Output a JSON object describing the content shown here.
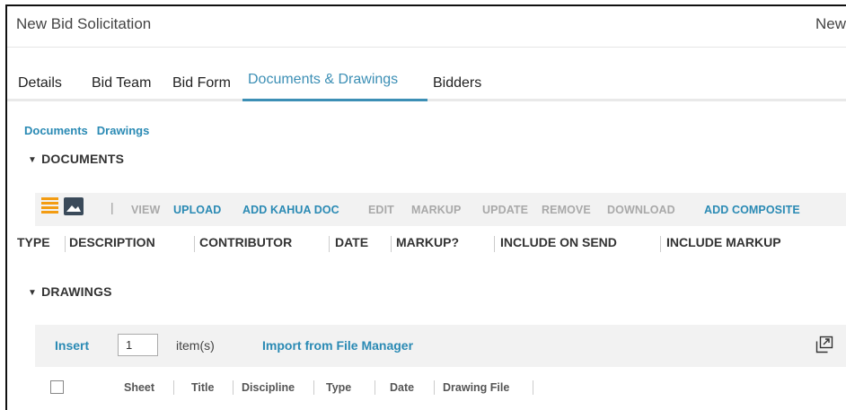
{
  "header": {
    "title": "New Bid Solicitation",
    "title_right": "New"
  },
  "tabs": [
    {
      "label": "Details"
    },
    {
      "label": "Bid Team"
    },
    {
      "label": "Bid Form"
    },
    {
      "label": "Documents & Drawings",
      "active": true
    },
    {
      "label": "Bidders"
    }
  ],
  "sublinks": [
    {
      "label": "Documents"
    },
    {
      "label": "Drawings"
    }
  ],
  "documents": {
    "heading": "DOCUMENTS",
    "toolbar": {
      "separator": "|",
      "buttons": [
        {
          "label": "VIEW",
          "enabled": false
        },
        {
          "label": "UPLOAD",
          "enabled": true
        },
        {
          "label": "ADD KAHUA DOC",
          "enabled": true
        },
        {
          "label": "EDIT",
          "enabled": false
        },
        {
          "label": "MARKUP",
          "enabled": false
        },
        {
          "label": "UPDATE",
          "enabled": false
        },
        {
          "label": "REMOVE",
          "enabled": false
        },
        {
          "label": "DOWNLOAD",
          "enabled": false
        },
        {
          "label": "ADD COMPOSITE",
          "enabled": true
        }
      ]
    },
    "columns": [
      "TYPE",
      "DESCRIPTION",
      "CONTRIBUTOR",
      "DATE",
      "MARKUP?",
      "INCLUDE ON SEND",
      "INCLUDE MARKUP"
    ]
  },
  "drawings": {
    "heading": "DRAWINGS",
    "toolbar": {
      "insert_label": "Insert",
      "count_value": "1",
      "items_label": "item(s)",
      "import_label": "Import from File Manager"
    },
    "columns": [
      "Sheet",
      "Title",
      "Discipline",
      "Type",
      "Date",
      "Drawing File"
    ]
  },
  "colors": {
    "accent": "#3c8fb5",
    "link": "#2a8ab4",
    "disabled": "#a9a9a9",
    "toolbar_bg": "#f2f2f2",
    "list_icon": "#f39c12"
  },
  "icons": [
    "list-view-icon",
    "image-view-icon",
    "caret-down-icon",
    "popout-icon"
  ]
}
